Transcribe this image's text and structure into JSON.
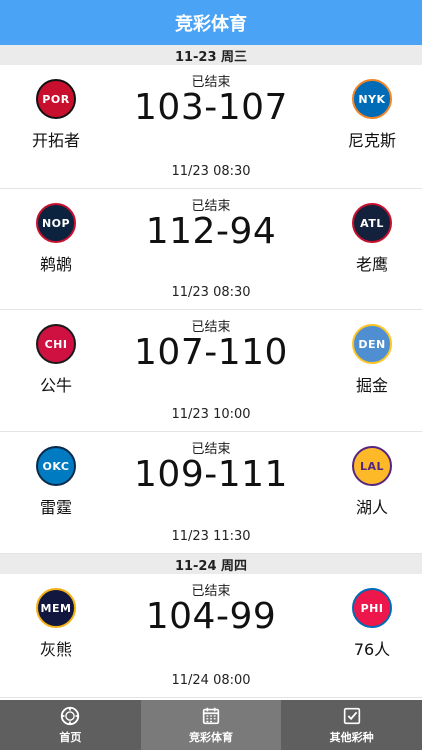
{
  "header": {
    "title": "竞彩体育"
  },
  "days": [
    {
      "date_label": "11-23 周三",
      "matches": [
        {
          "status": "已结束",
          "score": "103-107",
          "time": "11/23 08:30",
          "home": {
            "abbr": "POR",
            "name": "开拓者",
            "color": "#c8102e",
            "ring": "#111111"
          },
          "away": {
            "abbr": "NYK",
            "name": "尼克斯",
            "color": "#006bb6",
            "ring": "#f58426"
          }
        },
        {
          "status": "已结束",
          "score": "112-94",
          "time": "11/23 08:30",
          "home": {
            "abbr": "NOP",
            "name": "鹈鹕",
            "color": "#0c2340",
            "ring": "#c8102e"
          },
          "away": {
            "abbr": "ATL",
            "name": "老鹰",
            "color": "#14213d",
            "ring": "#c8102e"
          }
        },
        {
          "status": "已结束",
          "score": "107-110",
          "time": "11/23 10:00",
          "home": {
            "abbr": "CHI",
            "name": "公牛",
            "color": "#ce1141",
            "ring": "#1a1a1a"
          },
          "away": {
            "abbr": "DEN",
            "name": "掘金",
            "color": "#4f8fd1",
            "ring": "#fec524"
          }
        },
        {
          "status": "已结束",
          "score": "109-111",
          "time": "11/23 11:30",
          "home": {
            "abbr": "OKC",
            "name": "雷霆",
            "color": "#007ac1",
            "ring": "#0b2a4a"
          },
          "away": {
            "abbr": "LAL",
            "name": "湖人",
            "color": "#fdb927",
            "ring": "#552583"
          }
        }
      ]
    },
    {
      "date_label": "11-24 周四",
      "matches": [
        {
          "status": "已结束",
          "score": "104-99",
          "time": "11/24 08:00",
          "home": {
            "abbr": "MEM",
            "name": "灰熊",
            "color": "#12173f",
            "ring": "#f5b112"
          },
          "away": {
            "abbr": "PHI",
            "name": "76人",
            "color": "#ed174c",
            "ring": "#006bb6"
          }
        }
      ]
    }
  ],
  "tabbar": {
    "items": [
      {
        "label": "首页",
        "icon": "chip-icon",
        "active": false
      },
      {
        "label": "竞彩体育",
        "icon": "calendar-icon",
        "active": true
      },
      {
        "label": "其他彩种",
        "icon": "checkbox-icon",
        "active": false
      }
    ]
  }
}
